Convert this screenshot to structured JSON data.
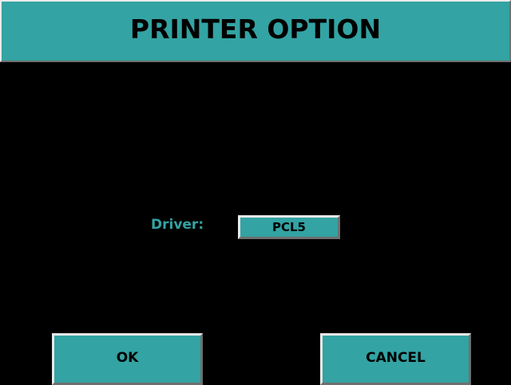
{
  "window": {
    "title": "PRINTER OPTION"
  },
  "driver": {
    "label": "Driver:",
    "value": "PCL5"
  },
  "buttons": {
    "ok_label": "OK",
    "cancel_label": "CANCEL"
  },
  "colors": {
    "background": "#000000",
    "accent": "#33a3a3"
  }
}
